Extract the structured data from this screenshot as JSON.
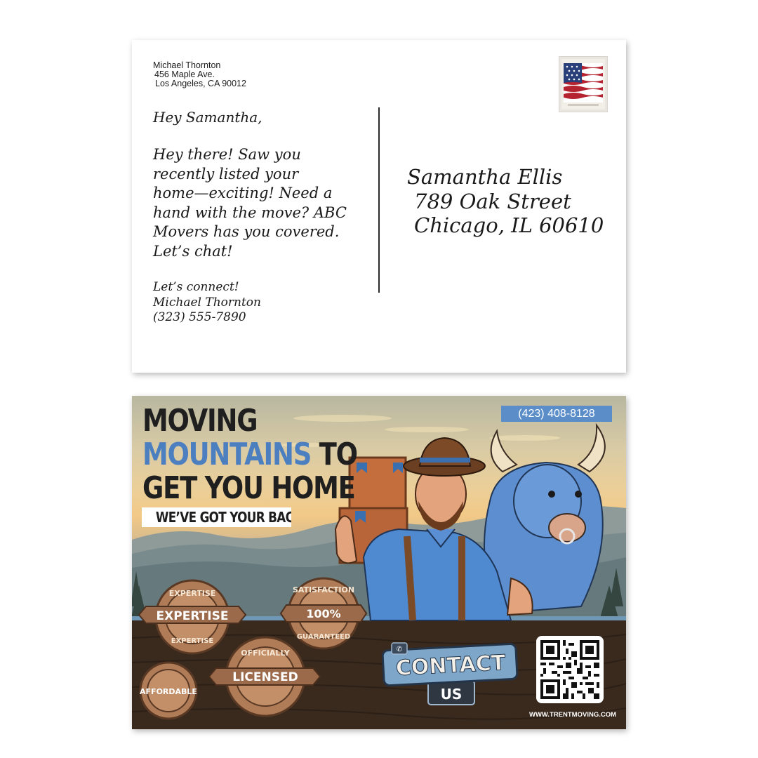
{
  "back": {
    "return_address": {
      "name": "Michael Thornton",
      "street": "456 Maple Ave.",
      "city": "Los Angeles, CA 90012"
    },
    "greeting": "Hey Samantha,",
    "message_lines": [
      "Hey there! Saw you",
      "recently listed your",
      "home—exciting! Need a",
      "hand with the move? ABC",
      "Movers has you covered.",
      "Let’s chat!"
    ],
    "signoff": {
      "closing": "Let’s connect!",
      "name": "Michael Thornton",
      "phone": "(323) 555-7890"
    },
    "recipient": {
      "name": "Samantha Ellis",
      "street": "789 Oak Street",
      "city": "Chicago, IL 60610"
    },
    "stamp_icon": "us-flag-stamp-icon"
  },
  "front": {
    "phone": "(423) 408-8128",
    "headline": {
      "line1": "MOVING",
      "line2_accent": "MOUNTAINS",
      "line2_rest": " TO",
      "line3": "GET YOU HOME"
    },
    "tagline": "WE’VE GOT YOUR BACK",
    "badges": {
      "expertise_ring_top": "EXPERTISE",
      "expertise_ribbon": "EXPERTISE",
      "expertise_ring_bottom": "EXPERTISE",
      "satisfaction_top": "SATISFACTION",
      "satisfaction_center": "100%",
      "satisfaction_bottom": "GUARANTEED",
      "affordable": "AFFORDABLE",
      "licensed_top": "OFFICIALLY",
      "licensed_ribbon": "LICENSED"
    },
    "contact_button": {
      "line1": "CONTACT",
      "line2": "US"
    },
    "website": "WWW.TRENTMOVING.COM",
    "colors": {
      "accent_blue": "#4c7fc0",
      "badge_blue": "#5b8ec9",
      "wood_dark": "#3a2a1e",
      "badge_tan": "#b07c58"
    }
  }
}
